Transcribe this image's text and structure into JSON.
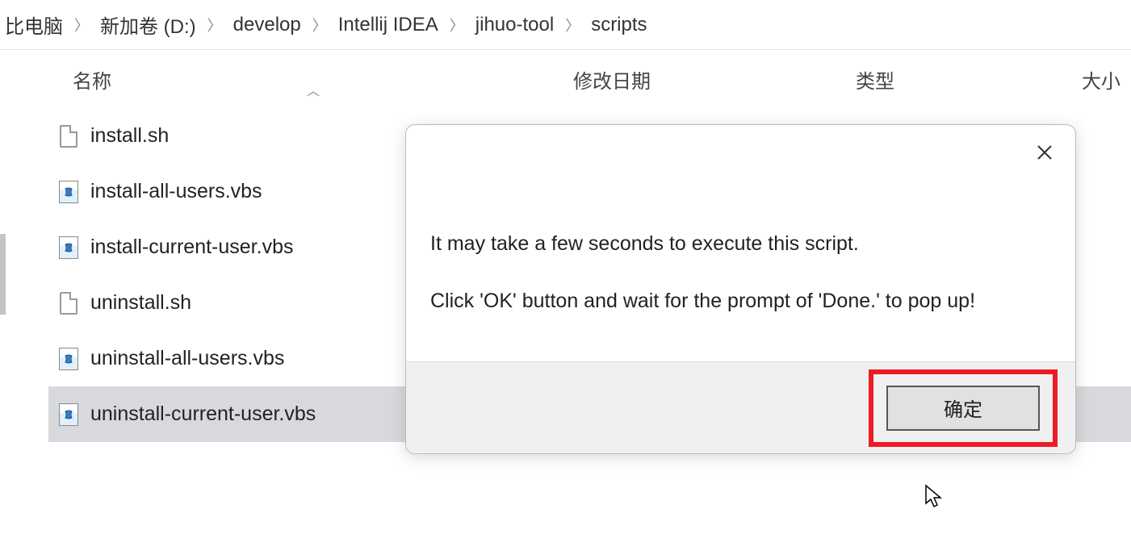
{
  "breadcrumb": {
    "items": [
      "比电脑",
      "新加卷 (D:)",
      "develop",
      "Intellij IDEA",
      "jihuo-tool",
      "scripts"
    ]
  },
  "columns": {
    "name": "名称",
    "modified": "修改日期",
    "type": "类型",
    "size": "大小"
  },
  "files": [
    {
      "name": "install.sh",
      "icon": "generic",
      "selected": false
    },
    {
      "name": "install-all-users.vbs",
      "icon": "vbs",
      "selected": false
    },
    {
      "name": "install-current-user.vbs",
      "icon": "vbs",
      "selected": false
    },
    {
      "name": "uninstall.sh",
      "icon": "generic",
      "selected": false
    },
    {
      "name": "uninstall-all-users.vbs",
      "icon": "vbs",
      "selected": false
    },
    {
      "name": "uninstall-current-user.vbs",
      "icon": "vbs",
      "selected": true
    }
  ],
  "dialog": {
    "line1": "It may take a few seconds to execute this script.",
    "line2": "Click 'OK' button and wait for the prompt of 'Done.' to pop up!",
    "ok_label": "确定"
  }
}
